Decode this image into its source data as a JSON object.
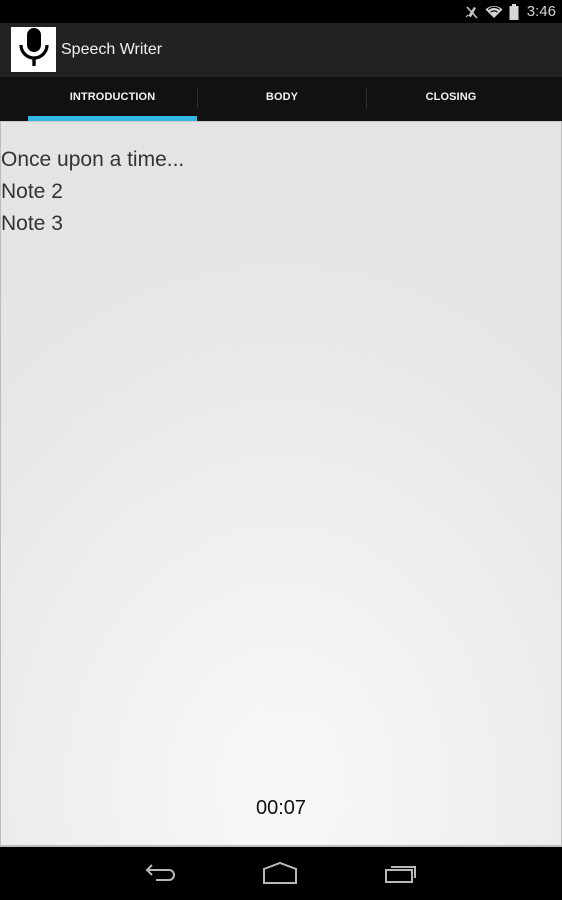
{
  "status_bar": {
    "icons": [
      "vibrate-mute-icon",
      "wifi-icon",
      "battery-icon"
    ],
    "time": "3:46"
  },
  "action_bar": {
    "app_icon": "microphone-icon",
    "title": "Speech Writer"
  },
  "tabs": [
    {
      "label": "INTRODUCTION",
      "selected": true
    },
    {
      "label": "BODY",
      "selected": false
    },
    {
      "label": "CLOSING",
      "selected": false
    }
  ],
  "colors": {
    "accent": "#33b5e5",
    "action_bar": "#222222",
    "tab_bar": "#111111"
  },
  "content": {
    "notes": [
      "Once upon a time...",
      "Note 2",
      "Note 3"
    ],
    "timer": "00:07"
  },
  "nav_bar": {
    "buttons": [
      "back-icon",
      "home-icon",
      "recent-apps-icon"
    ]
  }
}
